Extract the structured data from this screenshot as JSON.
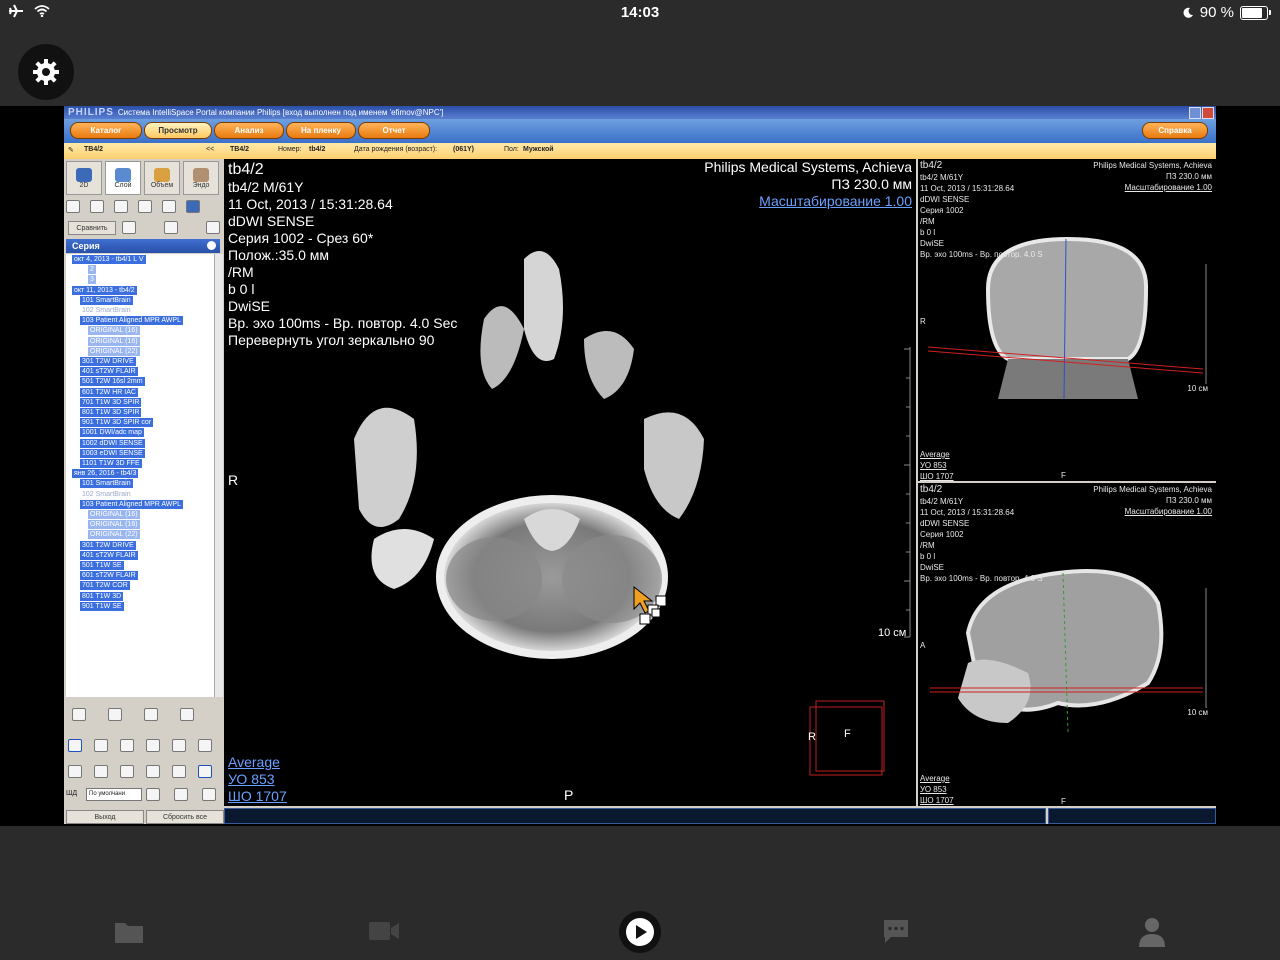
{
  "ios_status": {
    "time": "14:03",
    "battery": "90 %",
    "battery_level": 0.9
  },
  "app": {
    "brand": "PHILIPS",
    "window_title": "Система IntelliSpace Portal компании Philips [вход выполнен под именем 'efimov@NPC']",
    "tabs": [
      "Каталог",
      "Просмотр",
      "Анализ",
      "На пленку",
      "Отчет"
    ],
    "help_tab": "Справка",
    "active_tab": "Просмотр"
  },
  "infobar": {
    "patient_id": "TB4/2",
    "collapse": "<<",
    "patient_name": "TB4/2",
    "number_label": "Номер:",
    "number_value": "tb4/2",
    "dob_label": "Дата рождения (возраст):",
    "dob_value": "(061Y)",
    "sex_label": "Пол:",
    "sex_value": "Мужской"
  },
  "left_panel": {
    "modes": [
      "2D",
      "Слой",
      "Объем",
      "Эндо"
    ],
    "compare_button": "Сравнить",
    "series_header": "Серия",
    "tree": [
      {
        "label": "окт 4, 2013 - tb4/1 L V",
        "level": 0,
        "kind": "study"
      },
      {
        "label": "2",
        "level": 2,
        "kind": "sub"
      },
      {
        "label": "3",
        "level": 2,
        "kind": "sub"
      },
      {
        "label": "окт 11, 2013 - tb4/2",
        "level": 0,
        "kind": "study"
      },
      {
        "label": "101 SmartBrain",
        "level": 1,
        "kind": "series"
      },
      {
        "label": "102 SmartBrain",
        "level": 1,
        "kind": "plain"
      },
      {
        "label": "103 Patient Aligned MPR AWPL",
        "level": 1,
        "kind": "series"
      },
      {
        "label": "ORIGINAL (16)",
        "level": 2,
        "kind": "sub"
      },
      {
        "label": "ORIGINAL (16)",
        "level": 2,
        "kind": "sub"
      },
      {
        "label": "ORIGINAL (22)",
        "level": 2,
        "kind": "sub"
      },
      {
        "label": "301 T2W DRIVE",
        "level": 1,
        "kind": "series"
      },
      {
        "label": "401 sT2W FLAIR",
        "level": 1,
        "kind": "series"
      },
      {
        "label": "501 T2W 16sl 2mm",
        "level": 1,
        "kind": "series"
      },
      {
        "label": "601 T2W HR IAC",
        "level": 1,
        "kind": "series"
      },
      {
        "label": "701 T1W 3D SPIR",
        "level": 1,
        "kind": "series"
      },
      {
        "label": "801 T1W 3D SPIR",
        "level": 1,
        "kind": "series"
      },
      {
        "label": "901 T1W 3D SPIR cor",
        "level": 1,
        "kind": "series"
      },
      {
        "label": "1001 DWI/adc map",
        "level": 1,
        "kind": "series"
      },
      {
        "label": "1002 dDWI SENSE",
        "level": 1,
        "kind": "series"
      },
      {
        "label": "1003 eDWI SENSE",
        "level": 1,
        "kind": "series"
      },
      {
        "label": "1101 T1W 3D FFE",
        "level": 1,
        "kind": "series"
      },
      {
        "label": "янв 26, 2016 - tb4/3",
        "level": 0,
        "kind": "study"
      },
      {
        "label": "101 SmartBrain",
        "level": 1,
        "kind": "series"
      },
      {
        "label": "102 SmartBrain",
        "level": 1,
        "kind": "plain"
      },
      {
        "label": "103 Patient Aligned MPR AWPL",
        "level": 1,
        "kind": "series"
      },
      {
        "label": "ORIGINAL (16)",
        "level": 2,
        "kind": "sub"
      },
      {
        "label": "ORIGINAL (16)",
        "level": 2,
        "kind": "sub"
      },
      {
        "label": "ORIGINAL (22)",
        "level": 2,
        "kind": "sub"
      },
      {
        "label": "301 T2W DRIVE",
        "level": 1,
        "kind": "series"
      },
      {
        "label": "401 sT2W FLAIR",
        "level": 1,
        "kind": "series"
      },
      {
        "label": "501 T1W SE",
        "level": 1,
        "kind": "series"
      },
      {
        "label": "601 sT2W FLAIR",
        "level": 1,
        "kind": "series"
      },
      {
        "label": "701 T2W COR",
        "level": 1,
        "kind": "series"
      },
      {
        "label": "801 T1W 3D",
        "level": 1,
        "kind": "series"
      },
      {
        "label": "901 T1W SE",
        "level": 1,
        "kind": "series"
      }
    ],
    "shd_label": "ШД",
    "window_select": "По умолчани",
    "exit_button": "Выход",
    "reset_button": "Сбросить все"
  },
  "main_view": {
    "title": "tb4/2",
    "lines": [
      "tb4/2 M/61Y",
      "11 Oct, 2013 / 15:31:28.64",
      "dDWI SENSE",
      "Серия 1002 - Срез 60*",
      "Полож.:35.0 мм",
      "/RM",
      "b 0 l",
      "DwiSE",
      "Вр. эхо 100ms - Вр. повтор. 4.0 Sec",
      "Перевернуть угол зеркально 90"
    ],
    "vendor": "Philips Medical Systems, Achieva",
    "fov": "ПЗ 230.0 мм",
    "scale": "Масштабирование 1.00",
    "orient_left": "R",
    "orient_bottom": "P",
    "scale_bar": "10 см",
    "avg": "Average",
    "wl": "УО   853",
    "ww": "ШО  1707",
    "cube_r": "R",
    "cube_f": "F"
  },
  "side_top": {
    "title": "tb4/2",
    "lines": [
      "tb4/2 M/61Y",
      "11 Oct, 2013 / 15:31:28.64",
      "dDWI SENSE",
      "Серия 1002",
      "/RM",
      "b 0 l",
      "DwiSE",
      "Вр. эхо 100ms - Вр. повтор. 4.0 S"
    ],
    "vendor": "Philips Medical Systems, Achieva",
    "fov": "ПЗ 230.0 мм",
    "scale": "Масштабирование 1.00",
    "orient": "R",
    "bottom": "F",
    "scale_bar": "10 см",
    "avg": "Average",
    "wl": "УО   853",
    "ww": "ШО  1707"
  },
  "side_bottom": {
    "title": "tb4/2",
    "lines": [
      "tb4/2 M/61Y",
      "11 Oct, 2013 / 15:31:28.64",
      "dDWI SENSE",
      "Серия 1002",
      "/RM",
      "b 0 l",
      "DwiSE",
      "Вр. эхо 100ms - Вр. повтор. 4.0 S"
    ],
    "vendor": "Philips Medical Systems, Achieva",
    "fov": "ПЗ 230.0 мм",
    "scale": "Масштабирование 1.00",
    "orient": "A",
    "bottom": "F",
    "scale_bar": "10 см",
    "avg": "Average",
    "wl": "УО   853",
    "ww": "ШО  1707"
  },
  "bottom_nav": [
    "folder-icon",
    "video-camera-icon",
    "play-icon",
    "chat-icon",
    "person-icon"
  ],
  "colors": {
    "selection": "#3b6fe0",
    "orange": "#f08a1c",
    "link": "#6aa0ff",
    "red_line": "#d02020"
  }
}
